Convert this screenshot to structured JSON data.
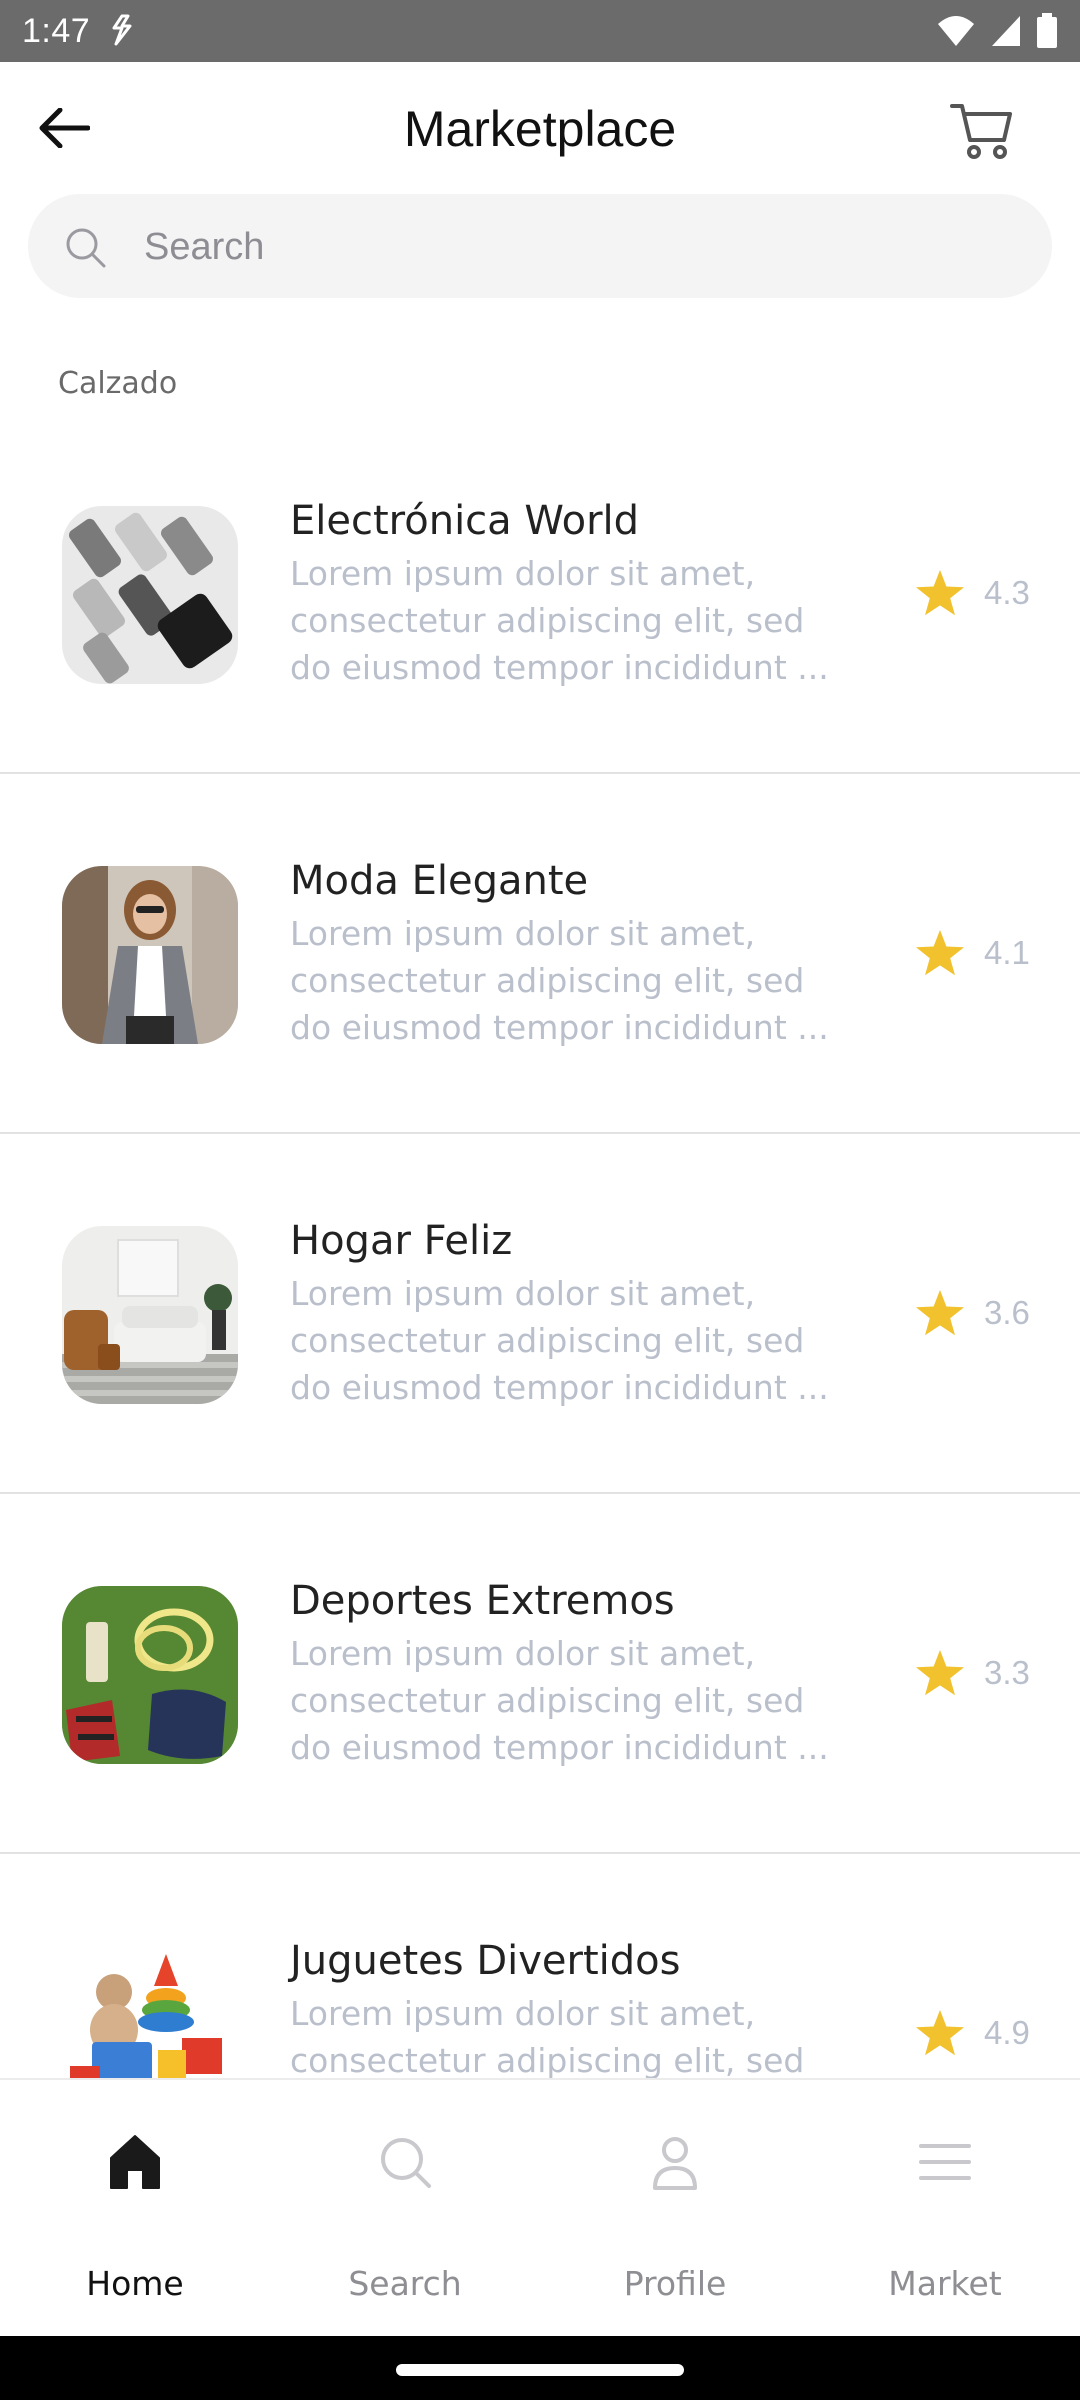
{
  "status_bar": {
    "time": "1:47"
  },
  "header": {
    "title": "Marketplace"
  },
  "search": {
    "placeholder": "Search"
  },
  "category": {
    "label": "Calzado"
  },
  "stores": [
    {
      "name": "Electrónica World",
      "description_lines": [
        "Lorem ipsum dolor sit amet,",
        "consectetur adipiscing elit, sed",
        "do eiusmod tempor incididunt ..."
      ],
      "rating": "4.3",
      "image_icon": "electronics-image"
    },
    {
      "name": "Moda Elegante",
      "description_lines": [
        "Lorem ipsum dolor sit amet,",
        "consectetur adipiscing elit, sed",
        "do eiusmod tempor incididunt ..."
      ],
      "rating": "4.1",
      "image_icon": "fashion-image"
    },
    {
      "name": "Hogar Feliz",
      "description_lines": [
        "Lorem ipsum dolor sit amet,",
        "consectetur adipiscing elit, sed",
        "do eiusmod tempor incididunt ..."
      ],
      "rating": "3.6",
      "image_icon": "home-image"
    },
    {
      "name": "Deportes Extremos",
      "description_lines": [
        "Lorem ipsum dolor sit amet,",
        "consectetur adipiscing elit, sed",
        "do eiusmod tempor incididunt ..."
      ],
      "rating": "3.3",
      "image_icon": "sports-image"
    },
    {
      "name": "Juguetes Divertidos",
      "description_lines": [
        "Lorem ipsum dolor sit amet,",
        "consectetur adipiscing elit, sed"
      ],
      "rating": "4.9",
      "image_icon": "toys-image"
    }
  ],
  "bottom_nav": {
    "items": [
      {
        "label": "Home",
        "icon": "home-icon",
        "active": true
      },
      {
        "label": "Search",
        "icon": "search-icon",
        "active": false
      },
      {
        "label": "Profile",
        "icon": "profile-icon",
        "active": false
      },
      {
        "label": "Market",
        "icon": "menu-icon",
        "active": false
      }
    ]
  },
  "colors": {
    "star": "#f2c12e",
    "muted_text": "#b9bfcb",
    "status_bar": "#6b6b6b"
  }
}
